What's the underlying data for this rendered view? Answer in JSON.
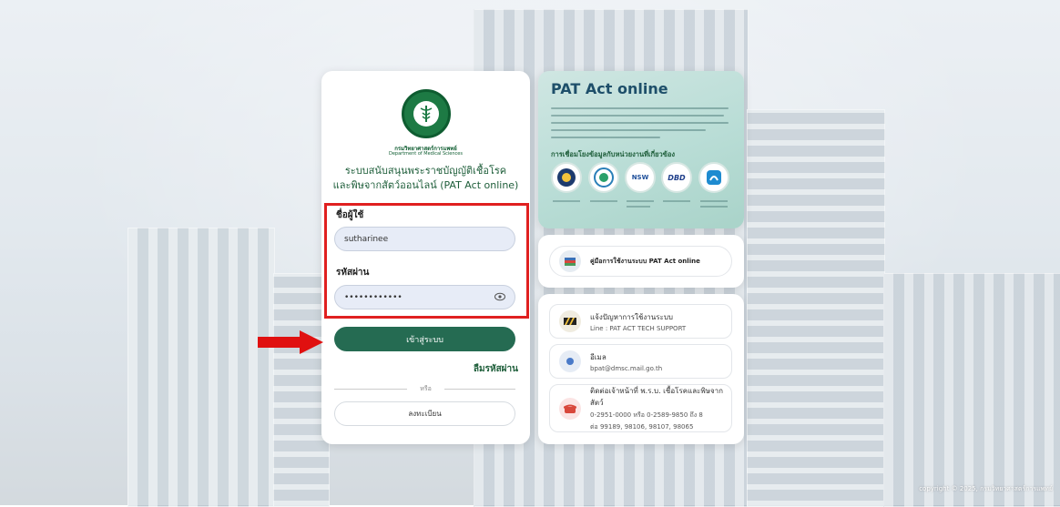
{
  "login": {
    "dept_th": "กรมวิทยาศาสตร์การแพทย์",
    "dept_en": "Department of Medical Sciences",
    "title_line1": "ระบบสนับสนุนพระราชบัญญัติเชื้อโรค",
    "title_line2": "และพิษจากสัตว์ออนไลน์ (PAT Act online)",
    "username_label": "ชื่อผู้ใช้",
    "username_value": "sutharinee",
    "password_label": "รหัสผ่าน",
    "password_value": "••••••••••••",
    "login_button": "เข้าสู่ระบบ",
    "forgot_password": "ลืมรหัสผ่าน",
    "or_text": "หรือ",
    "register_button": "ลงทะเบียน"
  },
  "banner": {
    "title": "PAT Act online",
    "subtitle": "การเชื่อมโยงข้อมูลกับหน่วยงานที่เกี่ยวข้อง",
    "logos": [
      "NSW",
      "DBD"
    ]
  },
  "manual": {
    "label": "คู่มือการใช้งานระบบ PAT Act online"
  },
  "contacts": [
    {
      "title": "แจ้งปัญหาการใช้งานระบบ",
      "sub": "Line : PAT ACT TECH SUPPORT"
    },
    {
      "title": "อีเมล",
      "sub": "bpat@dmsc.mail.go.th"
    },
    {
      "title": "ติดต่อเจ้าหน้าที่ พ.ร.บ. เชื้อโรคและพิษจากสัตว์",
      "sub": "0-2951-0000 หรือ 0-2589-9850 ถึง 8",
      "sub2": "ต่อ 99189, 98106, 98107, 98065"
    }
  ],
  "footer": {
    "copyright": "copyright © 2025, กรมวิทยาศาสตร์การแพทย์"
  },
  "colors": {
    "primary_green": "#256b52",
    "highlight_red": "#e02020",
    "input_bg": "#e7ecf7"
  }
}
